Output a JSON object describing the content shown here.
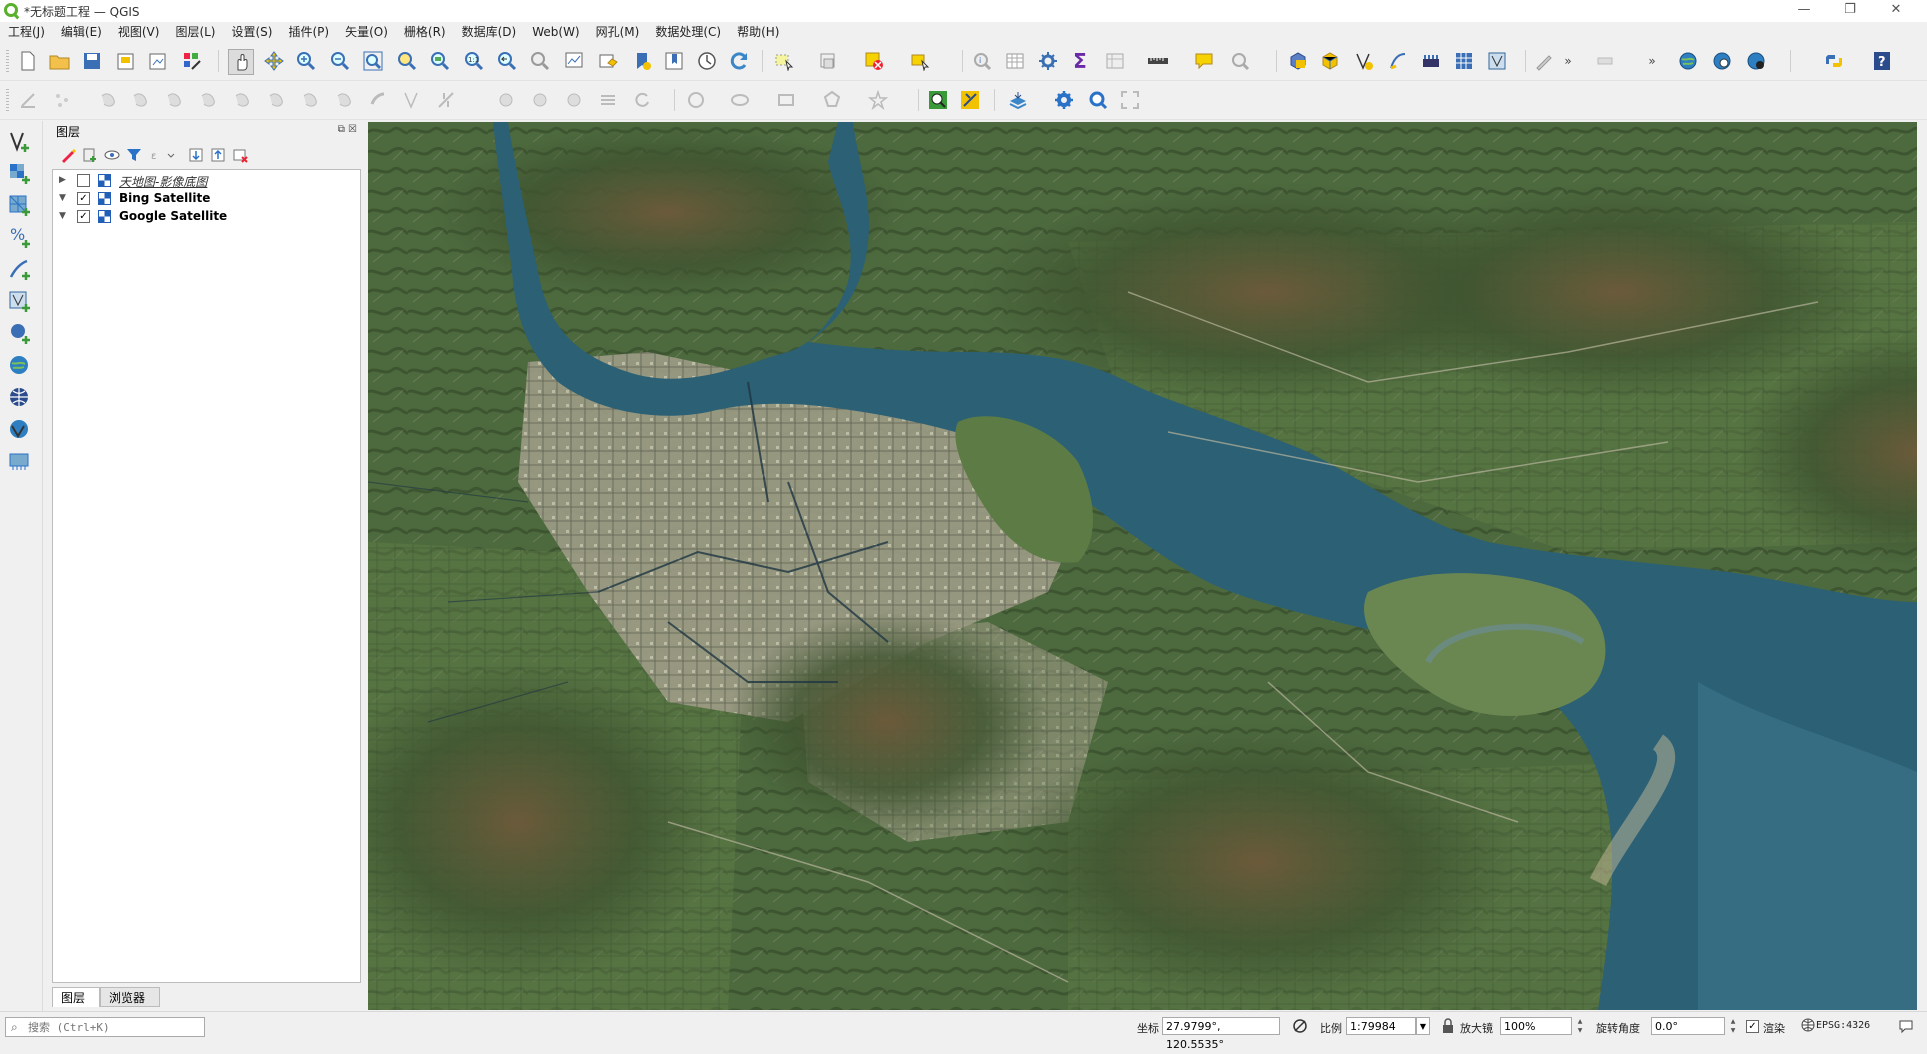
{
  "window": {
    "title": "*无标题工程 — QGIS",
    "minimize_glyph": "—",
    "restore_glyph": "❐",
    "close_glyph": "✕"
  },
  "menu": [
    "工程(J)",
    "编辑(E)",
    "视图(V)",
    "图层(L)",
    "设置(S)",
    "插件(P)",
    "矢量(O)",
    "栅格(R)",
    "数据库(D)",
    "Web(W)",
    "网孔(M)",
    "数据处理(C)",
    "帮助(H)"
  ],
  "toolbar": {
    "overflow": "»"
  },
  "layers_panel": {
    "title": "图层",
    "layers": [
      {
        "name": "天地图-影像底图",
        "checked": false,
        "style": "italic"
      },
      {
        "name": "Bing Satellite",
        "checked": true,
        "style": "bold"
      },
      {
        "name": "Google Satellite",
        "checked": true,
        "style": "bold"
      }
    ],
    "tabs": [
      "图层",
      "浏览器"
    ],
    "active_tab": "图层"
  },
  "status": {
    "search_placeholder": "搜索 (Ctrl+K)",
    "coord_label": "坐标",
    "coord_value": "27.9799°, 120.5535°",
    "scale_label": "比例",
    "scale_value": "1:79984",
    "magnifier_label": "放大镜",
    "magnifier_value": "100%",
    "rotation_label": "旋转角度",
    "rotation_value": "0.0°",
    "render_label": "渲染",
    "render_checked": true,
    "crs": "EPSG:4326"
  },
  "colors": {
    "river": "#2b6075",
    "land": "#4d6a3e",
    "urban": "#a8a58f",
    "qgis_green": "#58b02c"
  }
}
